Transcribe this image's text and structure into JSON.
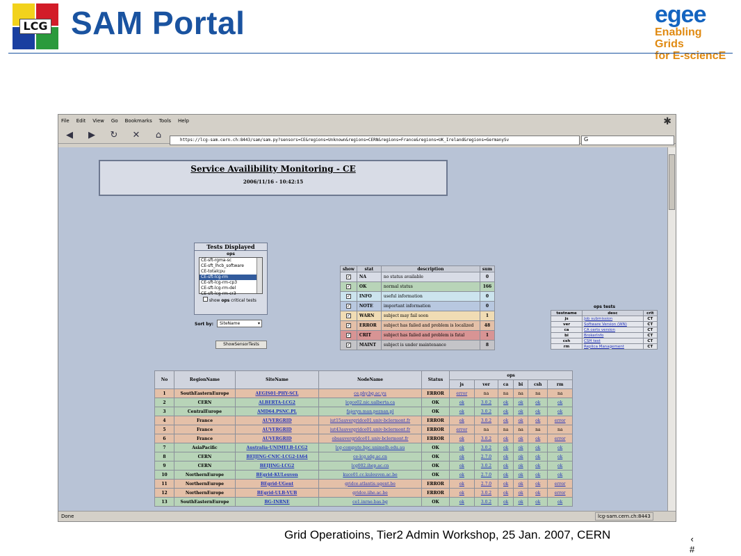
{
  "header": {
    "title": "SAM Portal",
    "left_logo_text": "LCG",
    "right_logo_word": "egee",
    "right_logo_line1": "Enabling Grids",
    "right_logo_line2": "for E-sciencE"
  },
  "browser": {
    "menu": [
      "File",
      "Edit",
      "View",
      "Go",
      "Bookmarks",
      "Tools",
      "Help"
    ],
    "url": "https://lcg-sam.cern.ch:8443/sam/sam.py?sensors=CE&regions=Unknown&regions=CERN&regions=France&regions=UK_Ireland&regions=GermanySv",
    "search_value": "G",
    "status_left": "Done",
    "status_host": "lcg-sam.cern.ch:8443"
  },
  "sam": {
    "heading": "Service Availibility Monitoring - CE",
    "datetime": "2006/11/16 - 10:42:15"
  },
  "tests_panel": {
    "title": "Tests Displayed",
    "subtitle": "ops",
    "items": [
      "CE-sft-rgma-sc",
      "CE-sft_lhcb_software",
      "CE-totalcpu",
      "CE-sft-lcg-rm",
      "CE-sft-lcg-rm-cp3",
      "CE-sft-lcg-rm-del",
      "CE-sft-lcg-rm-cr3"
    ],
    "selected_index": 3,
    "checkbox_pre": "show",
    "checkbox_bold": "ops",
    "checkbox_post": "critical tests",
    "sort_label": "Sort by:",
    "sort_value": "SiteName",
    "button": "ShowSensorTests"
  },
  "status_table": {
    "headers": [
      "show",
      "stat",
      "description",
      "sum"
    ],
    "rows": [
      {
        "stat": "NA",
        "desc": "no status available",
        "sum": "0",
        "color": "#d8dce6"
      },
      {
        "stat": "OK",
        "desc": "normal status",
        "sum": "166",
        "color": "#b8d4b8"
      },
      {
        "stat": "INFO",
        "desc": "useful information",
        "sum": "0",
        "color": "#cce4ee"
      },
      {
        "stat": "NOTE",
        "desc": "important information",
        "sum": "0",
        "color": "#b8c8e0"
      },
      {
        "stat": "WARN",
        "desc": "subject may fail soon",
        "sum": "1",
        "color": "#f0dcb4"
      },
      {
        "stat": "ERROR",
        "desc": "subject has failed and problem is localized",
        "sum": "48",
        "color": "#e4c0a8"
      },
      {
        "stat": "CRIT",
        "desc": "subject has failed and problem is fatal",
        "sum": "1",
        "color": "#d89494"
      },
      {
        "stat": "MAINT",
        "desc": "subject is under maintenance",
        "sum": "8",
        "color": "#c4c4c8"
      }
    ]
  },
  "ops_tests": {
    "title": "ops tests",
    "headers": [
      "testname",
      "desc",
      "crit"
    ],
    "rows": [
      [
        "js",
        "Job submission",
        "CT"
      ],
      [
        "ver",
        "Software Version (WN)",
        "CT"
      ],
      [
        "ca",
        "CA certs version",
        "CT"
      ],
      [
        "bi",
        "BrokerInfo",
        "CT"
      ],
      [
        "csh",
        "CSH test",
        "CT"
      ],
      [
        "rm",
        "Replica Management",
        "CT"
      ]
    ]
  },
  "main_table": {
    "headers": [
      "No",
      "RegionName",
      "SiteName",
      "NodeName",
      "Status"
    ],
    "group_header": "ops",
    "sub_headers": [
      "js",
      "ver",
      "ca",
      "bi",
      "csh",
      "rm"
    ],
    "rows": [
      [
        "1",
        "SouthEasternEurope",
        "AEGIS01-PHY-SCL",
        "ce.phy.bg.ac.yu",
        "ERROR",
        "error",
        "na",
        "na",
        "na",
        "na",
        "na"
      ],
      [
        "2",
        "CERN",
        "ALBERTA-LCG2",
        "lcgce02.nic.ualberta.ca",
        "OK",
        "ok",
        "3.0.2",
        "ok",
        "ok",
        "ok",
        "ok"
      ],
      [
        "3",
        "CentralEurope",
        "AMD64.PSNC.PL",
        "fajeryn.man.poznan.pl",
        "OK",
        "ok",
        "3.0.2",
        "ok",
        "ok",
        "ok",
        "ok"
      ],
      [
        "4",
        "France",
        "AUVERGRID",
        "iut15auvergridce01.univ-bclermont.fr",
        "ERROR",
        "ok",
        "3.0.2",
        "ok",
        "ok",
        "ok",
        "error"
      ],
      [
        "5",
        "France",
        "AUVERGRID",
        "iut43auvergridce01.univ-bclermont.fr",
        "ERROR",
        "error",
        "na",
        "na",
        "na",
        "na",
        "na"
      ],
      [
        "6",
        "France",
        "AUVERGRID",
        "obsauvergridce01.univ-bclermont.fr",
        "ERROR",
        "ok",
        "3.0.2",
        "ok",
        "ok",
        "ok",
        "error"
      ],
      [
        "7",
        "AsiaPacific",
        "Australia-UNIMELB-LCG2",
        "lcg-compute.hpc.unimelb.edu.au",
        "OK",
        "ok",
        "3.0.2",
        "ok",
        "ok",
        "ok",
        "ok"
      ],
      [
        "8",
        "CERN",
        "BEIJING-CNIC-LCG2-IA64",
        "ce-lcg.sdg.ac.cn",
        "OK",
        "ok",
        "2.7.0",
        "ok",
        "ok",
        "ok",
        "ok"
      ],
      [
        "9",
        "CERN",
        "BEIJING-LCG2",
        "lcg002.ihep.ac.cn",
        "OK",
        "ok",
        "3.0.2",
        "ok",
        "ok",
        "ok",
        "ok"
      ],
      [
        "10",
        "NorthernEurope",
        "BEgrid-KULeuven",
        "kuce01.cc.kuleuven.ac.be",
        "OK",
        "ok",
        "2.7.0",
        "ok",
        "ok",
        "ok",
        "ok"
      ],
      [
        "11",
        "NorthernEurope",
        "BEgrid-UGent",
        "gridce.atlantis.ugent.be",
        "ERROR",
        "ok",
        "2.7.0",
        "ok",
        "ok",
        "ok",
        "error"
      ],
      [
        "12",
        "NorthernEurope",
        "BEgrid-ULB-VUB",
        "gridce.iihe.ac.be",
        "ERROR",
        "ok",
        "3.0.2",
        "ok",
        "ok",
        "ok",
        "error"
      ],
      [
        "13",
        "SouthEasternEurope",
        "BG-INRNE",
        "ce1.inrne.bas.bg",
        "OK",
        "ok",
        "3.0.2",
        "ok",
        "ok",
        "ok",
        "ok"
      ]
    ]
  },
  "colors": {
    "ok_row": "#b8d4b8",
    "error_row": "#e4c0a8",
    "title_blue": "#1a53a0"
  },
  "footer": {
    "text": "Grid Operatioins, Tier2 Admin Workshop, 25 Jan. 2007, CERN",
    "page_a": "‹",
    "page_b": "#"
  }
}
